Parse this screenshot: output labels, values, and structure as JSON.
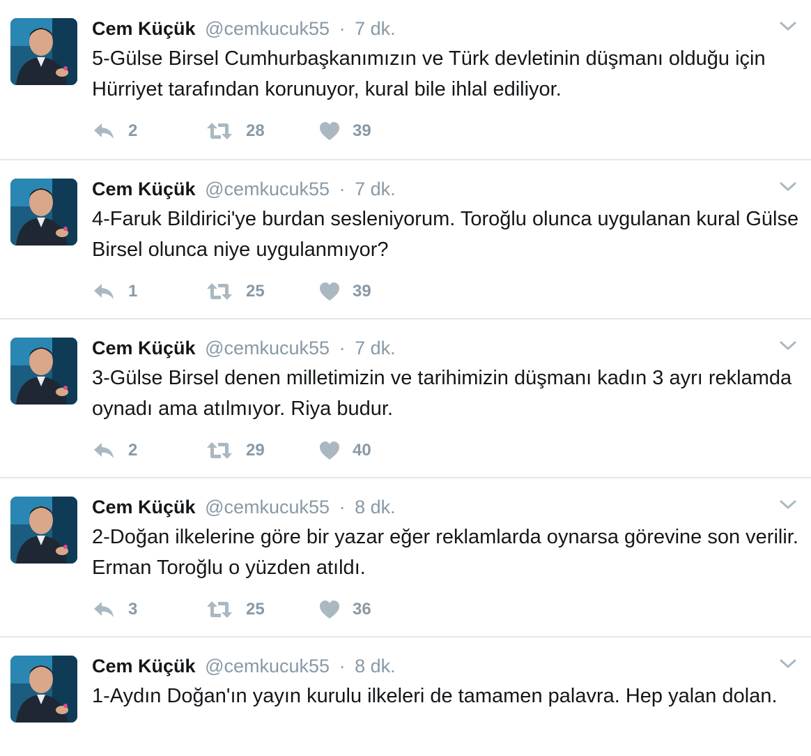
{
  "tweets": [
    {
      "fullname": "Cem Küçük",
      "username": "@cemkucuk55",
      "separator": "·",
      "time": "7 dk.",
      "text": "5-Gülse Birsel Cumhurbaşkanımızın ve Türk devletinin düşmanı olduğu için Hürriyet tarafından korunuyor, kural bile ihlal ediliyor.",
      "replies": "2",
      "retweets": "28",
      "likes": "39"
    },
    {
      "fullname": "Cem Küçük",
      "username": "@cemkucuk55",
      "separator": "·",
      "time": "7 dk.",
      "text": "4-Faruk Bildirici'ye burdan sesleniyorum. Toroğlu olunca uygulanan kural Gülse Birsel olunca niye uygulanmıyor?",
      "replies": "1",
      "retweets": "25",
      "likes": "39"
    },
    {
      "fullname": "Cem Küçük",
      "username": "@cemkucuk55",
      "separator": "·",
      "time": "7 dk.",
      "text": "3-Gülse Birsel denen milletimizin ve tarihimizin düşmanı kadın 3 ayrı reklamda oynadı ama atılmıyor. Riya budur.",
      "replies": "2",
      "retweets": "29",
      "likes": "40"
    },
    {
      "fullname": "Cem Küçük",
      "username": "@cemkucuk55",
      "separator": "·",
      "time": "8 dk.",
      "text": "2-Doğan ilkelerine göre bir yazar eğer reklamlarda oynarsa görevine son verilir. Erman Toroğlu o yüzden atıldı.",
      "replies": "3",
      "retweets": "25",
      "likes": "36"
    },
    {
      "fullname": "Cem Küçük",
      "username": "@cemkucuk55",
      "separator": "·",
      "time": "8 dk.",
      "text": "1-Aydın Doğan'ın yayın kurulu ilkeleri de tamamen palavra. Hep yalan dolan.",
      "replies": "",
      "retweets": "",
      "likes": ""
    }
  ],
  "icons": {
    "reply": "reply-icon",
    "retweet": "retweet-icon",
    "like": "heart-icon",
    "caret": "chevron-down-icon",
    "avatar": "avatar"
  },
  "colors": {
    "icon_gray": "#aab8c2",
    "meta_gray": "#8899a6",
    "divider": "#e1e8ed",
    "text": "#14171a"
  }
}
